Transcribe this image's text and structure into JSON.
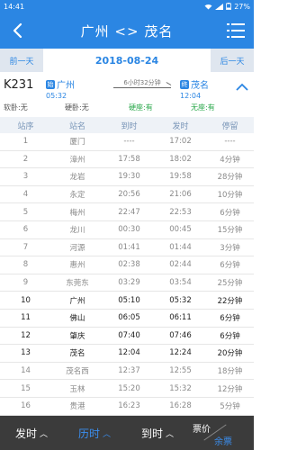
{
  "status_bar": {
    "time": "14:41",
    "battery": "27%"
  },
  "nav": {
    "title": "广州 <> 茂名",
    "back_icon": "back-arrow-icon",
    "menu_icon": "menu-icon"
  },
  "date_bar": {
    "prev_label": "前一天",
    "date": "2018-08-24",
    "next_label": "后一天"
  },
  "train": {
    "number": "K231",
    "from": {
      "badge": "始",
      "name": "广州",
      "time": "05:32"
    },
    "to": {
      "badge": "终",
      "name": "茂名",
      "time": "12:04"
    },
    "duration": "6小时32分钟"
  },
  "seats": {
    "s1_label": "软卧:无",
    "s2_label": "硬卧:无",
    "s3_label": "硬座:有",
    "s4_label": "无座:有"
  },
  "table": {
    "headers": {
      "idx": "站序",
      "station": "站名",
      "arrive": "到时",
      "depart": "发时",
      "stay": "停留"
    },
    "rows": [
      {
        "idx": "1",
        "station": "厦门",
        "arrive": "----",
        "depart": "17:02",
        "stay": "----",
        "style": "gray"
      },
      {
        "idx": "2",
        "station": "漳州",
        "arrive": "17:58",
        "depart": "18:02",
        "stay": "4分钟",
        "style": "gray"
      },
      {
        "idx": "3",
        "station": "龙岩",
        "arrive": "19:30",
        "depart": "19:58",
        "stay": "28分钟",
        "style": "gray"
      },
      {
        "idx": "4",
        "station": "永定",
        "arrive": "20:56",
        "depart": "21:06",
        "stay": "10分钟",
        "style": "gray"
      },
      {
        "idx": "5",
        "station": "梅州",
        "arrive": "22:47",
        "depart": "22:53",
        "stay": "6分钟",
        "style": "gray"
      },
      {
        "idx": "6",
        "station": "龙川",
        "arrive": "00:30",
        "depart": "00:45",
        "stay": "15分钟",
        "style": "gray"
      },
      {
        "idx": "7",
        "station": "河源",
        "arrive": "01:41",
        "depart": "01:44",
        "stay": "3分钟",
        "style": "gray"
      },
      {
        "idx": "8",
        "station": "惠州",
        "arrive": "02:38",
        "depart": "02:44",
        "stay": "6分钟",
        "style": "gray"
      },
      {
        "idx": "9",
        "station": "东莞东",
        "arrive": "03:29",
        "depart": "03:54",
        "stay": "25分钟",
        "style": "gray"
      },
      {
        "idx": "10",
        "station": "广州",
        "arrive": "05:10",
        "depart": "05:32",
        "stay": "22分钟",
        "style": "dark"
      },
      {
        "idx": "11",
        "station": "佛山",
        "arrive": "06:05",
        "depart": "06:11",
        "stay": "6分钟",
        "style": "dark"
      },
      {
        "idx": "12",
        "station": "肇庆",
        "arrive": "07:40",
        "depart": "07:46",
        "stay": "6分钟",
        "style": "dark"
      },
      {
        "idx": "13",
        "station": "茂名",
        "arrive": "12:04",
        "depart": "12:24",
        "stay": "20分钟",
        "style": "dark"
      },
      {
        "idx": "14",
        "station": "茂名西",
        "arrive": "12:37",
        "depart": "12:55",
        "stay": "18分钟",
        "style": "gray"
      },
      {
        "idx": "15",
        "station": "玉林",
        "arrive": "15:20",
        "depart": "15:32",
        "stay": "12分钟",
        "style": "gray"
      },
      {
        "idx": "16",
        "station": "贵港",
        "arrive": "16:23",
        "depart": "16:28",
        "stay": "5分钟",
        "style": "gray"
      }
    ]
  },
  "bottom_bar": {
    "depart_label": "发时",
    "duration_label": "历时",
    "arrive_label": "到时",
    "price_label": "票价",
    "remain_label": "余票"
  },
  "colors": {
    "primary": "#2b86e3",
    "available": "#2aa84b",
    "bottom_bg": "#3b3b3b"
  }
}
